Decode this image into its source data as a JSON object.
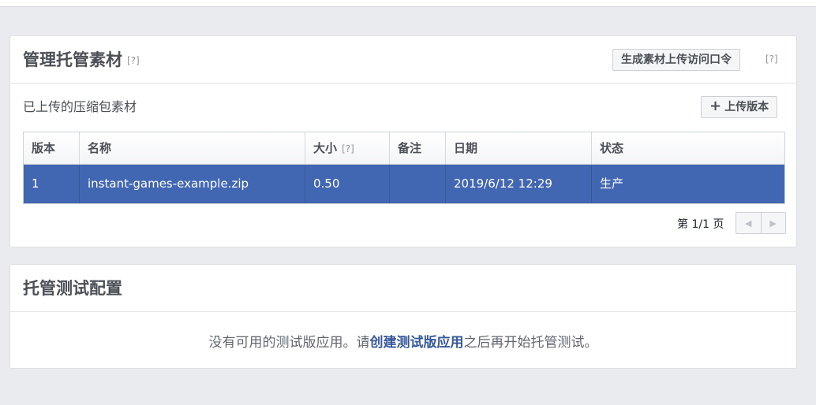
{
  "hosted_assets": {
    "title": "管理托管素材",
    "title_help": "[?]",
    "token_button": "生成素材上传访问口令",
    "token_help": "[?]",
    "subtitle": "已上传的压缩包素材",
    "upload_button": "上传版本",
    "upload_icon": "plus-icon",
    "table": {
      "headers": {
        "version": "版本",
        "name": "名称",
        "size": "大小",
        "size_help": "[?]",
        "notes": "备注",
        "date": "日期",
        "status": "状态"
      },
      "rows": [
        {
          "version": "1",
          "name": "instant-games-example.zip",
          "size": "0.50",
          "notes": "",
          "date": "2019/6/12 12:29",
          "status": "生产"
        }
      ],
      "selected_row_color": "#4267b2"
    },
    "pagination": {
      "label": "第 1/1 页",
      "prev_icon": "triangle-left-icon",
      "next_icon": "triangle-right-icon"
    }
  },
  "hosted_testing": {
    "title": "托管测试配置",
    "message_before": "没有可用的测试版应用。请",
    "message_link": "创建测试版应用",
    "message_after": "之后再开始托管测试。"
  },
  "colors": {
    "background": "#e9ebee",
    "accent": "#4267b2",
    "link": "#365899"
  }
}
